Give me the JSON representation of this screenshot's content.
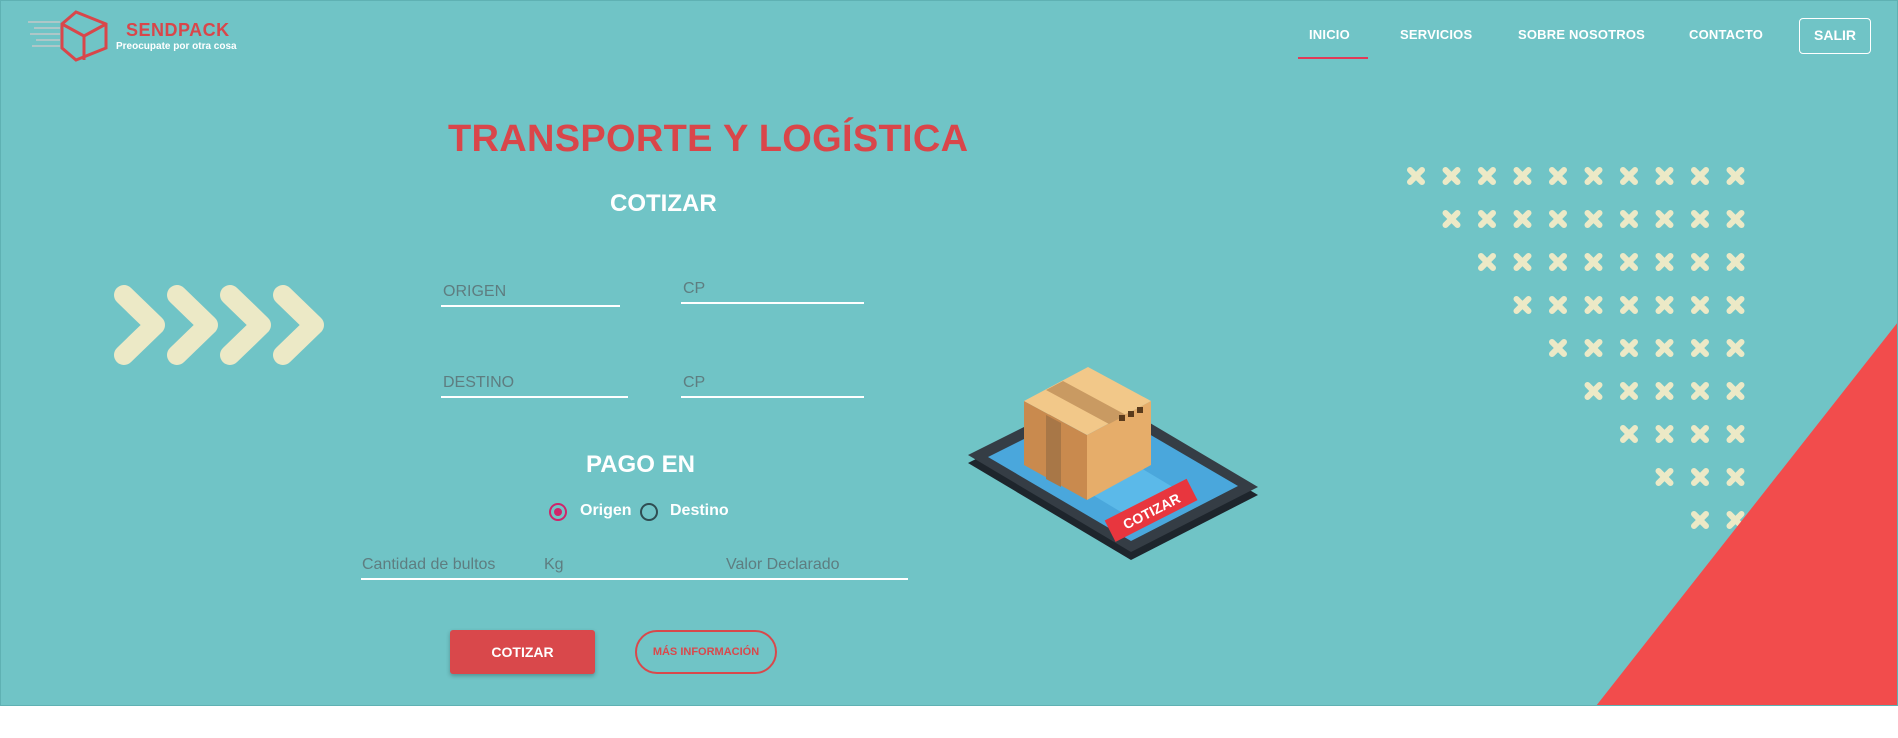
{
  "brand": {
    "name": "SENDPACK",
    "tagline": "Preocupate por otra cosa"
  },
  "nav": {
    "items": [
      "INICIO",
      "SERVICIOS",
      "SOBRE NOSOTROS",
      "CONTACTO"
    ],
    "active": "INICIO",
    "logout_label": "SALIR"
  },
  "hero": {
    "title": "TRANSPORTE Y LOGÍSTICA",
    "subtitle": "COTIZAR",
    "origin_placeholder": "ORIGEN",
    "origin_cp_placeholder": "CP",
    "dest_placeholder": "DESTINO",
    "dest_cp_placeholder": "CP",
    "payment_title": "PAGO EN",
    "payment_options": [
      "Origen",
      "Destino"
    ],
    "payment_selected": "Origen",
    "bultos_placeholder": "Cantidad de bultos",
    "kg_placeholder": "Kg",
    "valor_placeholder": "Valor Declarado",
    "cotizar_button": "COTIZAR",
    "info_button": "MÁS INFORMACIÓN",
    "illustration_label": "COTIZAR"
  },
  "icons": [
    "sendpack-logo-icon",
    "chevron-decoration-icon",
    "cross-pattern-icon",
    "tablet-package-illustration"
  ],
  "colors": {
    "background": "#70c4c6",
    "accent": "#d9464a",
    "cream": "#ece9c6",
    "triangle": "#f24c4c",
    "radio": "#d0246a"
  }
}
